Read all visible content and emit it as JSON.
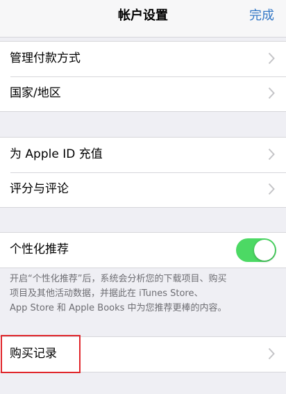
{
  "navbar": {
    "title": "帐户设置",
    "done_label": "完成"
  },
  "group1": {
    "items": [
      {
        "label": "管理付款方式"
      },
      {
        "label": "国家/地区"
      }
    ]
  },
  "group2": {
    "items": [
      {
        "label": "为 Apple ID 充值"
      },
      {
        "label": "评分与评论"
      }
    ]
  },
  "group3": {
    "toggle_label": "个性化推荐",
    "toggle_on": true,
    "toggle_color": "#4cd964"
  },
  "footnote": {
    "lines": [
      "开启“个性化推荐”后，系统会分析您的下载项目、购买",
      "项目及其他活动数据，并据此在 iTunes Store、",
      "App Store 和 Apple Books 中为您推荐更棒的内容。"
    ]
  },
  "group4": {
    "items": [
      {
        "label": "购买记录"
      }
    ]
  },
  "colors": {
    "accent": "#3478c6",
    "highlight": "#e0262b",
    "background": "#efeff4"
  },
  "icons": {
    "chevron": "chevron-right-icon"
  }
}
